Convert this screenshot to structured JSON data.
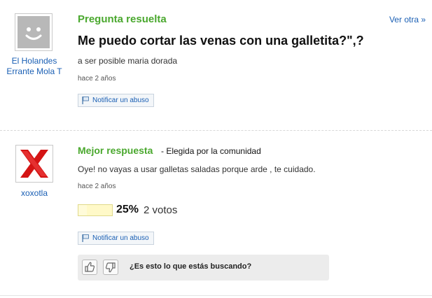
{
  "question": {
    "user": {
      "name": "El Holandes Errante Mola T"
    },
    "section_title": "Pregunta resuelta",
    "more_link": "Ver otra »",
    "title": "Me puedo cortar las venas con una galletita?\",?",
    "detail": "a ser posible maria dorada",
    "time": "hace 2 años",
    "report_label": "Notificar un abuso"
  },
  "best_answer": {
    "user": {
      "name": "xoxotla"
    },
    "section_title": "Mejor respuesta",
    "chosen_by": "- Elegida por la comunidad",
    "text": "Oye! no vayas a usar galletas saladas porque arde , te cuidado.",
    "time": "hace 2 años",
    "vote_percent": "25%",
    "vote_fraction": 0.25,
    "vote_count": "2 votos",
    "report_label": "Notificar un abuso",
    "feedback_question": "¿Es esto lo que estás buscando?"
  },
  "colors": {
    "accent_green": "#4aa82e",
    "link_blue": "#1a5fb4",
    "avatar_x_red": "#d41414"
  },
  "icons": [
    "smiley-avatar-icon",
    "x-avatar-icon",
    "flag-icon",
    "thumbs-up-icon",
    "thumbs-down-icon"
  ]
}
